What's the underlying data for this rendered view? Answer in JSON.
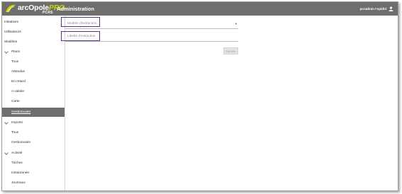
{
  "header": {
    "logo_text_a": "arcOpole",
    "logo_text_b": "PRO",
    "logo_sub": "PCRS",
    "title": "Administration",
    "user_name": "pcradmin I'opidnl"
  },
  "sidebar": {
    "items": [
      {
        "label": "Initiatives",
        "level": 0
      },
      {
        "label": "Utilisateurs",
        "level": 0
      },
      {
        "label": "Modèles",
        "level": 0
      },
      {
        "label": "Plans",
        "level": 0,
        "expandable": true
      },
      {
        "label": "Tous",
        "level": 1
      },
      {
        "label": "Attendus",
        "level": 1
      },
      {
        "label": "En retard",
        "level": 1
      },
      {
        "label": "A valider",
        "level": 1
      },
      {
        "label": "Carte",
        "level": 1
      },
      {
        "label": "Gestionnaire",
        "level": 1,
        "active": true
      },
      {
        "label": "Imports",
        "level": 0,
        "expandable": true
      },
      {
        "label": "Tous",
        "level": 1
      },
      {
        "label": "Gestionnaire",
        "level": 1
      },
      {
        "label": "Activité",
        "level": 0,
        "expandable": true
      },
      {
        "label": "Tâches",
        "level": 1
      },
      {
        "label": "Instantanée",
        "level": 1
      },
      {
        "label": "Journaux",
        "level": 1
      }
    ]
  },
  "form": {
    "model_placeholder": "Modèle d'extraction",
    "label_placeholder": "Libellé d'extraction",
    "submit_label": "Extraire"
  },
  "colors": {
    "topbar": "#6e6e6e",
    "accent": "#c8d400",
    "highlight": "#5b2d8e"
  }
}
